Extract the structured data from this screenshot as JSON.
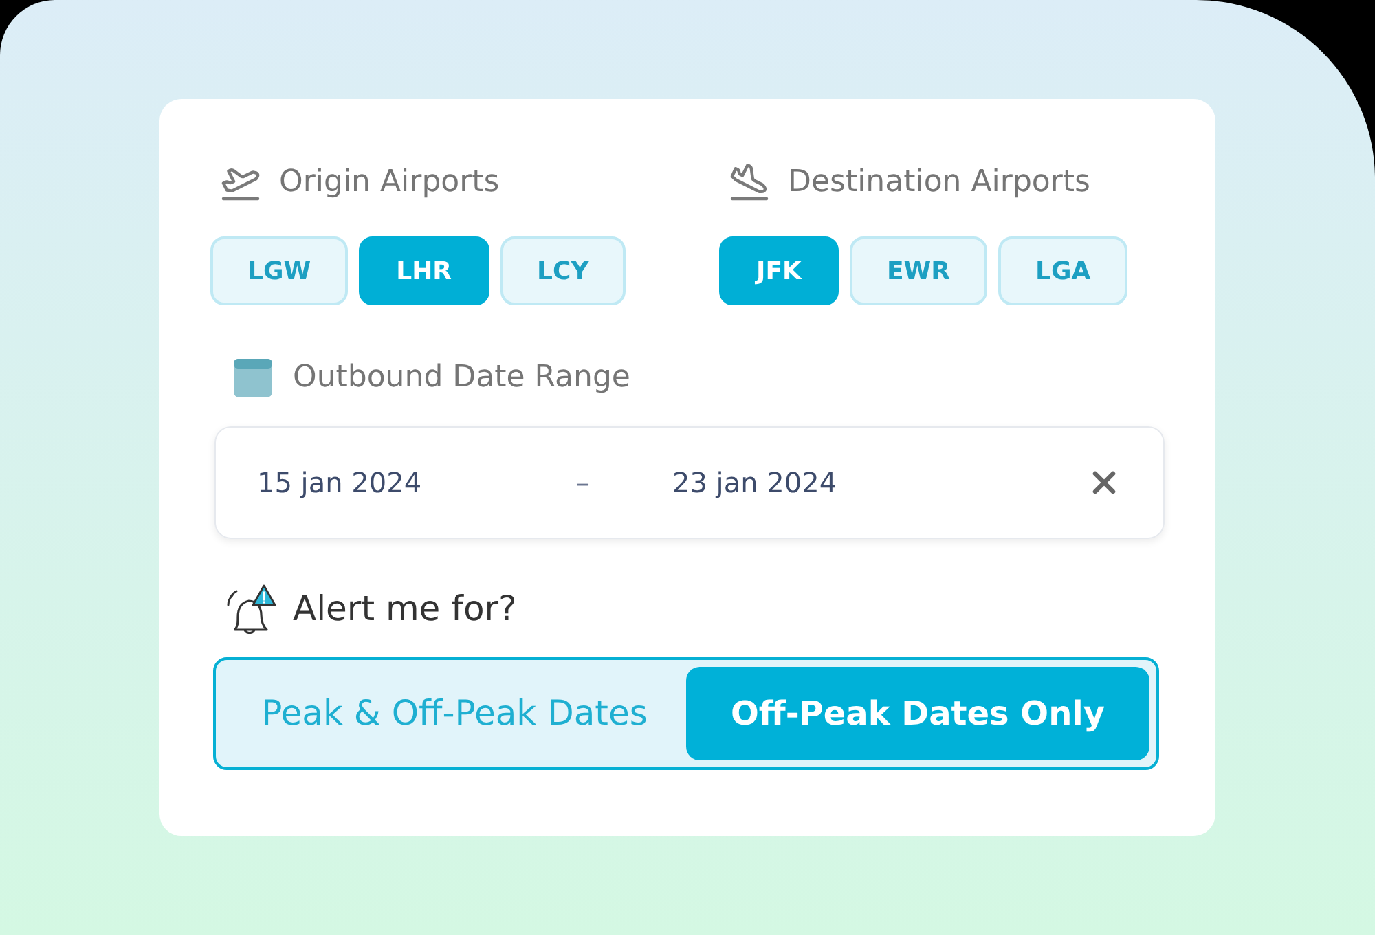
{
  "origin": {
    "label": "Origin Airports",
    "airports": [
      {
        "code": "LGW",
        "selected": false
      },
      {
        "code": "LHR",
        "selected": true
      },
      {
        "code": "LCY",
        "selected": false
      }
    ]
  },
  "destination": {
    "label": "Destination Airports",
    "airports": [
      {
        "code": "JFK",
        "selected": true
      },
      {
        "code": "EWR",
        "selected": false
      },
      {
        "code": "LGA",
        "selected": false
      }
    ]
  },
  "date_range": {
    "label": "Outbound Date Range",
    "start": "15 jan 2024",
    "separator": "–",
    "end": "23 jan 2024"
  },
  "alert": {
    "label": "Alert me for?",
    "options": [
      {
        "label": "Peak & Off-Peak Dates",
        "selected": false
      },
      {
        "label": "Off-Peak Dates Only",
        "selected": true
      }
    ]
  }
}
